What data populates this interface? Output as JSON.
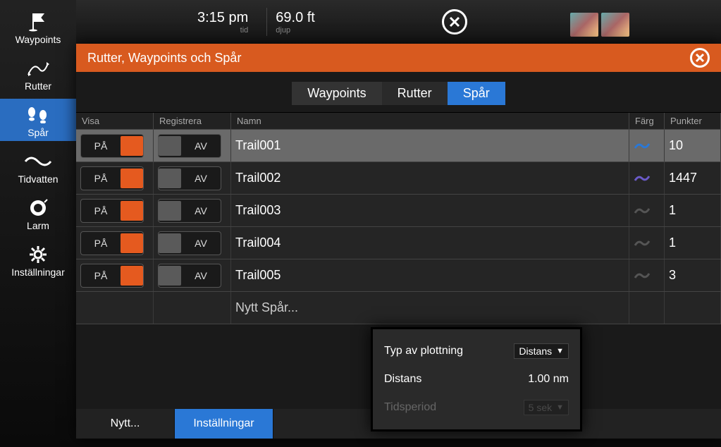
{
  "topbar": {
    "time": "3:15 pm",
    "time_label": "tid",
    "depth": "69.0 ft",
    "depth_label": "djup"
  },
  "sidebar": {
    "items": [
      {
        "label": "Waypoints"
      },
      {
        "label": "Rutter"
      },
      {
        "label": "Spår"
      },
      {
        "label": "Tidvatten"
      },
      {
        "label": "Larm"
      },
      {
        "label": "Inställningar"
      }
    ]
  },
  "dialog": {
    "title": "Rutter, Waypoints och Spår"
  },
  "tabs": {
    "waypoints": "Waypoints",
    "rutter": "Rutter",
    "spar": "Spår"
  },
  "columns": {
    "visa": "Visa",
    "registrera": "Registrera",
    "namn": "Namn",
    "farg": "Färg",
    "punkter": "Punkter"
  },
  "toggle_labels": {
    "on": "PÅ",
    "off": "AV"
  },
  "rows": [
    {
      "visa": true,
      "reg": false,
      "namn": "Trail001",
      "color": "#2a78d6",
      "punkter": "10"
    },
    {
      "visa": true,
      "reg": false,
      "namn": "Trail002",
      "color": "#5a4ab0",
      "punkter": "1447"
    },
    {
      "visa": true,
      "reg": false,
      "namn": "Trail003",
      "color": "#444",
      "punkter": "1"
    },
    {
      "visa": true,
      "reg": false,
      "namn": "Trail004",
      "color": "#444",
      "punkter": "1"
    },
    {
      "visa": true,
      "reg": false,
      "namn": "Trail005",
      "color": "#444",
      "punkter": "3"
    }
  ],
  "new_track_label": "Nytt Spår...",
  "bottom": {
    "new": "Nytt...",
    "settings": "Inställningar"
  },
  "settings_popup": {
    "plot_type_label": "Typ av plottning",
    "plot_type_value": "Distans",
    "distance_label": "Distans",
    "distance_value": "1.00 nm",
    "period_label": "Tidsperiod",
    "period_value": "5 sek"
  }
}
